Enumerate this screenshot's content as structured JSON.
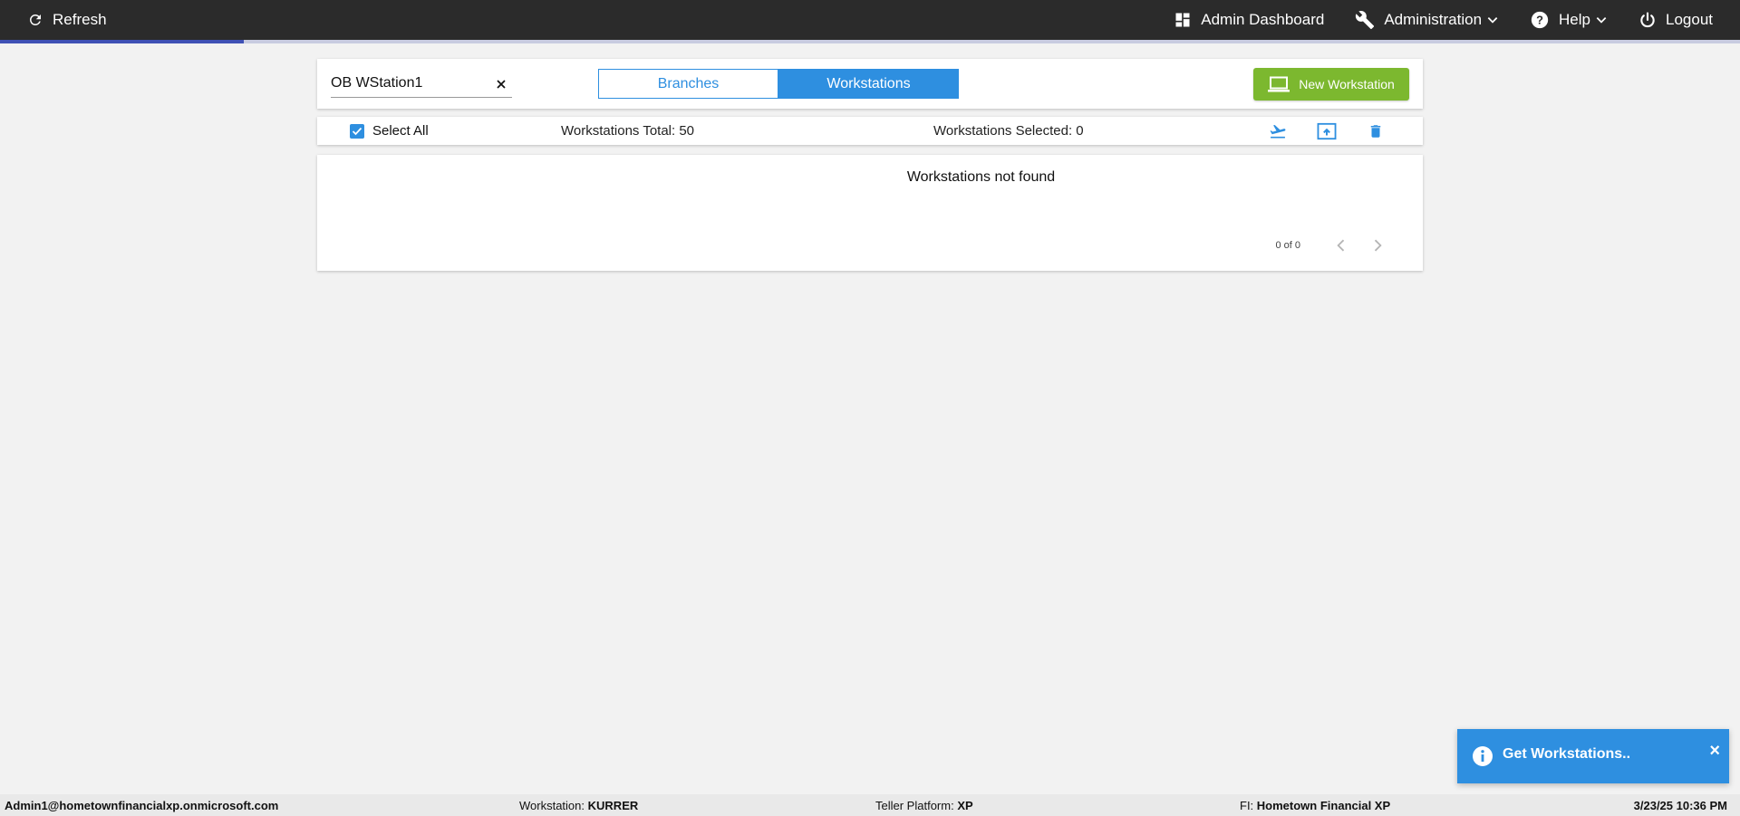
{
  "topbar": {
    "refresh_label": "Refresh",
    "admin_dashboard_label": "Admin Dashboard",
    "administration_label": "Administration",
    "help_label": "Help",
    "logout_label": "Logout",
    "progress_percent": 14
  },
  "header": {
    "search_value": "OB WStation1",
    "tabs": [
      {
        "label": "Branches",
        "active": false
      },
      {
        "label": "Workstations",
        "active": true
      }
    ],
    "new_button_label": "New Workstation"
  },
  "toolbar": {
    "select_all_label": "Select All",
    "select_all_checked": true,
    "total_text": "Workstations Total: 50",
    "selected_text": "Workstations Selected: 0",
    "icons": [
      "flight-takeoff-icon",
      "upload-icon",
      "trash-icon"
    ]
  },
  "results": {
    "empty_message": "Workstations not found",
    "pager_text": "0 of 0"
  },
  "toast": {
    "message": "Get Workstations..",
    "close_glyph": "×"
  },
  "footer": {
    "user": "Admin1@hometownfinancialxp.onmicrosoft.com",
    "workstation_label": "Workstation:",
    "workstation_value": "KURRER",
    "platform_label": "Teller Platform:",
    "platform_value": "XP",
    "fi_label": "FI:",
    "fi_value": "Hometown Financial XP",
    "datetime": "3/23/25 10:36 PM"
  },
  "colors": {
    "accent": "#2e8fe0",
    "topbar": "#2b2b2b",
    "new_button": "#7cb82f",
    "progress": "#3f51b5"
  }
}
